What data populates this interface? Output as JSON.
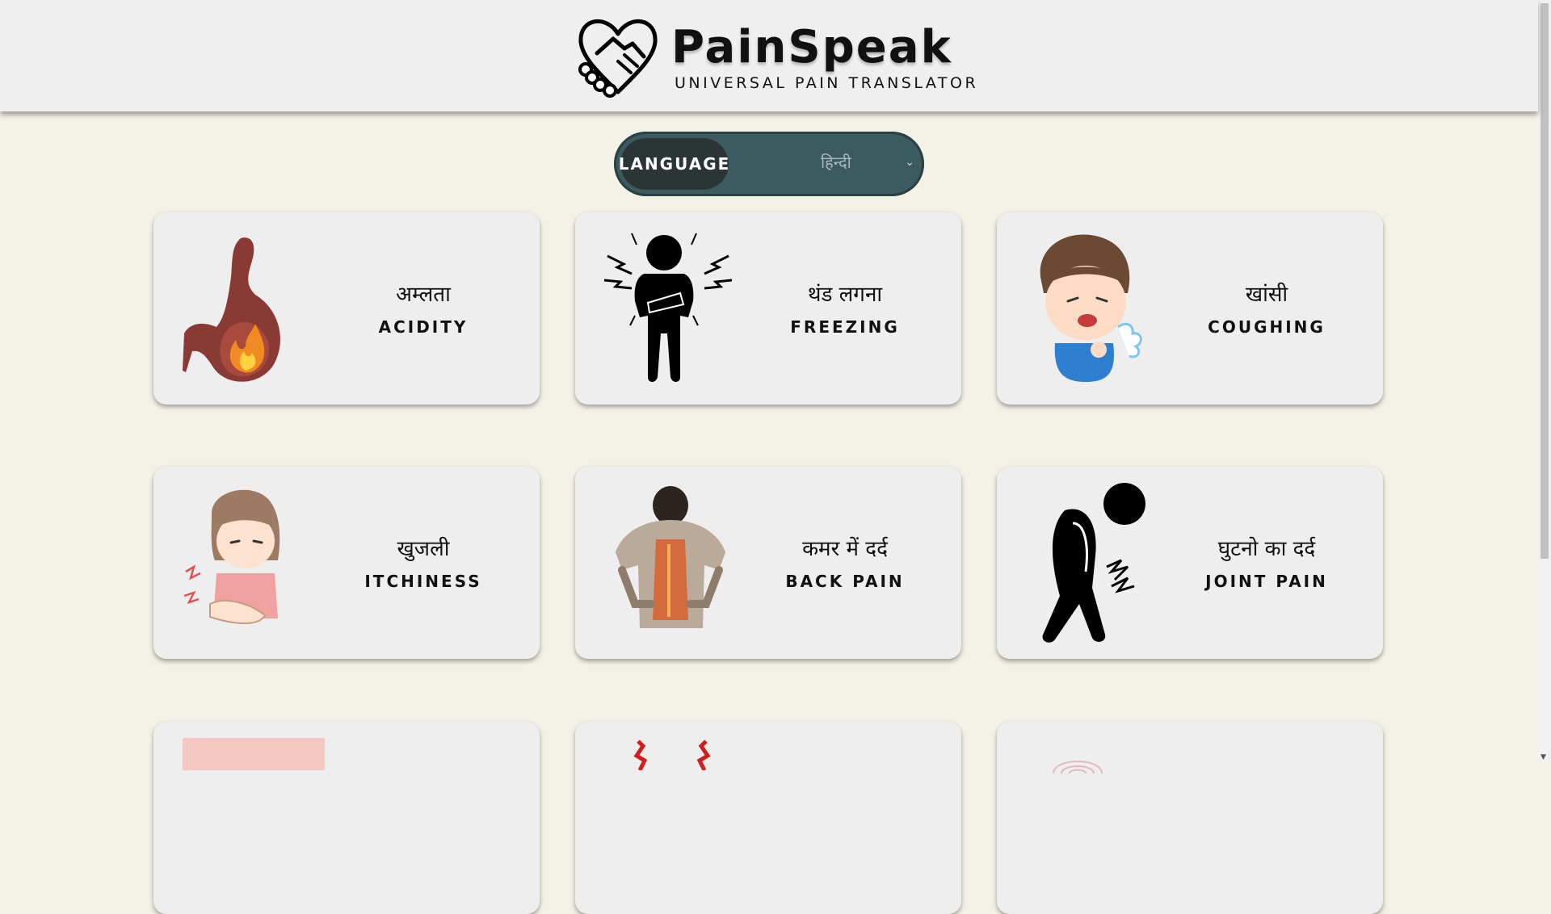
{
  "brand": {
    "name": "PainSpeak",
    "tagline": "UNIVERSAL PAIN TRANSLATOR",
    "logo_icon": "handshake-heart-icon"
  },
  "language": {
    "label": "LANGUAGE",
    "selected": "हिन्दी",
    "chevron_icon": "chevron-down-icon"
  },
  "colors": {
    "background": "#f4f1e6",
    "header": "#efefef",
    "card": "#eeeeee",
    "language_pill": "#3b5b61",
    "language_label": "#2b3536"
  },
  "cards": [
    {
      "native": "अम्लता",
      "english": "ACIDITY",
      "icon": "stomach-fire-icon"
    },
    {
      "native": "थंड लगना",
      "english": "FREEZING",
      "icon": "shivering-person-icon"
    },
    {
      "native": "खांसी",
      "english": "COUGHING",
      "icon": "coughing-boy-icon"
    },
    {
      "native": "खुजली",
      "english": "ITCHINESS",
      "icon": "itching-girl-icon"
    },
    {
      "native": "कमर में दर्द",
      "english": "BACK PAIN",
      "icon": "back-pain-icon"
    },
    {
      "native": "घुटनो का दर्द",
      "english": "JOINT PAIN",
      "icon": "joint-pain-person-icon"
    }
  ]
}
